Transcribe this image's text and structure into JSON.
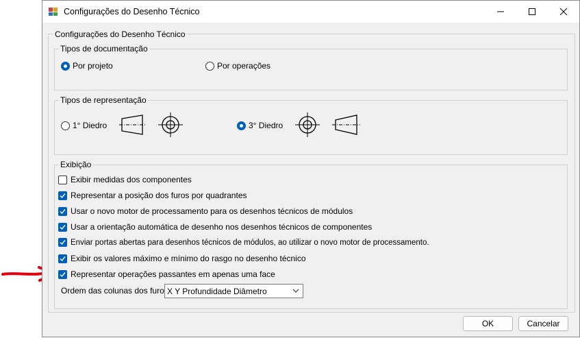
{
  "window": {
    "title": "Configurações do Desenho Técnico",
    "controls": [
      "minimize-icon",
      "maximize-icon",
      "close-icon"
    ]
  },
  "main_group": {
    "label": "Configurações do Desenho Técnico"
  },
  "documentation": {
    "label": "Tipos de documentação",
    "options": [
      {
        "label": "Por projeto",
        "checked": true
      },
      {
        "label": "Por operações",
        "checked": false
      }
    ]
  },
  "representation": {
    "label": "Tipos de representação",
    "options": [
      {
        "label": "1° Diedro",
        "checked": false
      },
      {
        "label": "3° Diedro",
        "checked": true
      }
    ]
  },
  "display": {
    "label": "Exibição",
    "checkboxes": [
      {
        "label": "Exibir medidas dos componentes",
        "checked": false
      },
      {
        "label": "Representar a posição dos furos por quadrantes",
        "checked": true
      },
      {
        "label": "Usar o novo motor de processamento para os desenhos técnicos de módulos",
        "checked": true
      },
      {
        "label": "Usar a orientação automática de desenho nos desenhos técnicos de componentes",
        "checked": true
      },
      {
        "label": "Enviar portas abertas para desenhos técnicos de módulos, ao utilizar o novo motor de processamento.",
        "checked": true
      },
      {
        "label": "Exibir os valores máximo e mínimo do rasgo no desenho técnico",
        "checked": true
      },
      {
        "label": "Representar operações passantes em apenas uma face",
        "checked": true
      }
    ],
    "column_order_label": "Ordem das colunas dos furos",
    "column_order_value": "X Y Profundidade Diâmetro"
  },
  "buttons": {
    "ok": "OK",
    "cancel": "Cancelar"
  },
  "colors": {
    "accent": "#005fb8",
    "annotation_arrow": "#e3000f"
  }
}
